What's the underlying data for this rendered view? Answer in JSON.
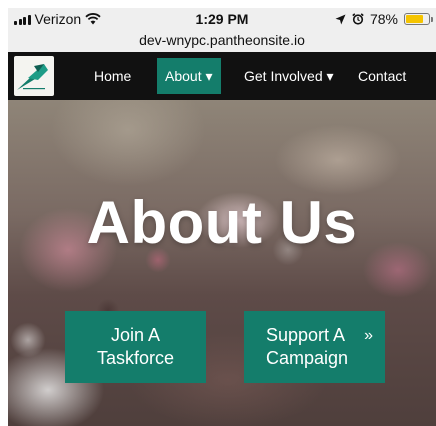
{
  "status_bar": {
    "carrier": "Verizon",
    "time": "1:29 PM",
    "battery_percent": "78%",
    "battery_level": 0.78,
    "icons": [
      "signal-icon",
      "wifi-icon",
      "location-arrow-icon",
      "alarm-icon",
      "battery-icon"
    ]
  },
  "browser": {
    "url": "dev-wnypc.pantheonsite.io"
  },
  "nav": {
    "items": [
      {
        "label": "Home"
      },
      {
        "label": "About ▾"
      },
      {
        "label": "Get Involved ▾"
      },
      {
        "label": "Contact"
      }
    ]
  },
  "hero": {
    "title": "About Us",
    "buttons": [
      {
        "line1": "Join A",
        "line2": "Taskforce"
      },
      {
        "line1": "Support A",
        "line2": "Campaign",
        "arrow": "»"
      }
    ]
  },
  "colors": {
    "accent": "#147d6b",
    "nav_background": "#111111",
    "battery": "#f5c400"
  }
}
